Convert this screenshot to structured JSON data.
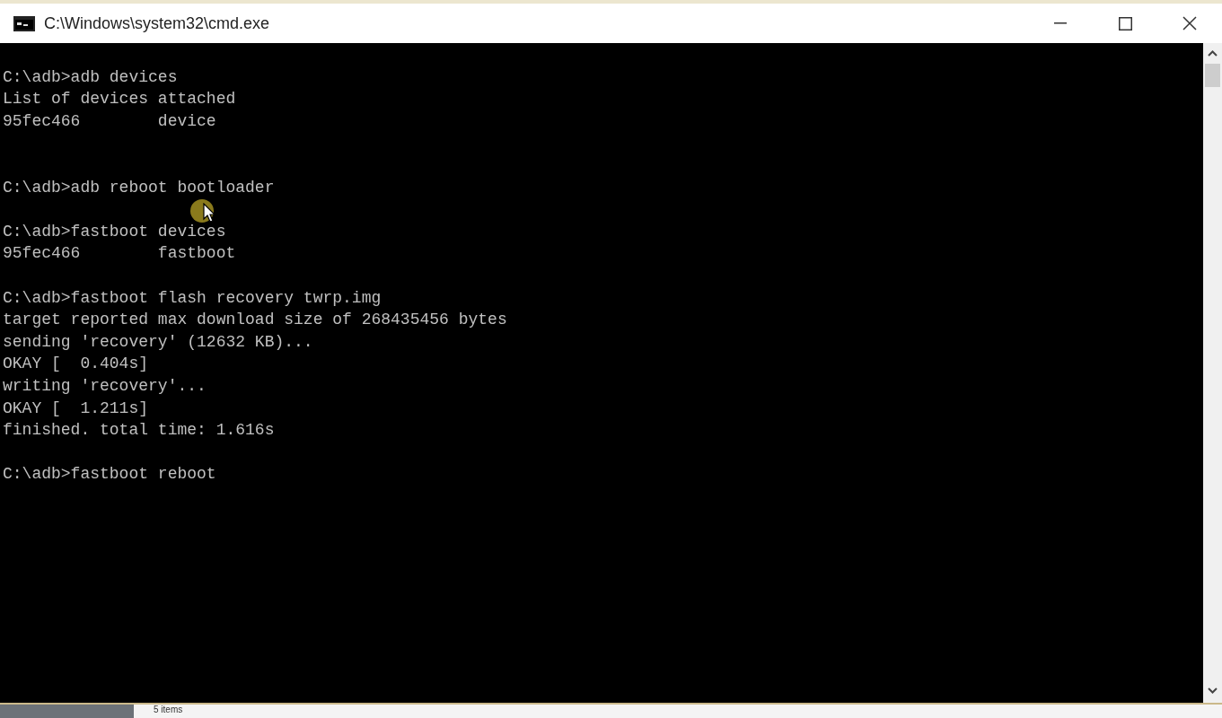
{
  "window": {
    "title": "C:\\Windows\\system32\\cmd.exe"
  },
  "console": {
    "lines": [
      {
        "kind": "blank"
      },
      {
        "kind": "text",
        "text": "C:\\adb>adb devices"
      },
      {
        "kind": "text",
        "text": "List of devices attached"
      },
      {
        "kind": "text",
        "text": "95fec466        device"
      },
      {
        "kind": "blank"
      },
      {
        "kind": "blank"
      },
      {
        "kind": "text",
        "text": "C:\\adb>adb reboot bootloader"
      },
      {
        "kind": "blank"
      },
      {
        "kind": "text",
        "text": "C:\\adb>fastboot devices"
      },
      {
        "kind": "text",
        "text": "95fec466        fastboot"
      },
      {
        "kind": "blank"
      },
      {
        "kind": "text",
        "text": "C:\\adb>fastboot flash recovery twrp.img"
      },
      {
        "kind": "text",
        "text": "target reported max download size of 268435456 bytes"
      },
      {
        "kind": "text",
        "text": "sending 'recovery' (12632 KB)..."
      },
      {
        "kind": "text",
        "text": "OKAY [  0.404s]"
      },
      {
        "kind": "text",
        "text": "writing 'recovery'..."
      },
      {
        "kind": "text",
        "text": "OKAY [  1.211s]"
      },
      {
        "kind": "text",
        "text": "finished. total time: 1.616s"
      },
      {
        "kind": "blank"
      },
      {
        "kind": "text",
        "text": "C:\\adb>fastboot reboot"
      }
    ]
  },
  "background": {
    "status_text": "5 items"
  }
}
